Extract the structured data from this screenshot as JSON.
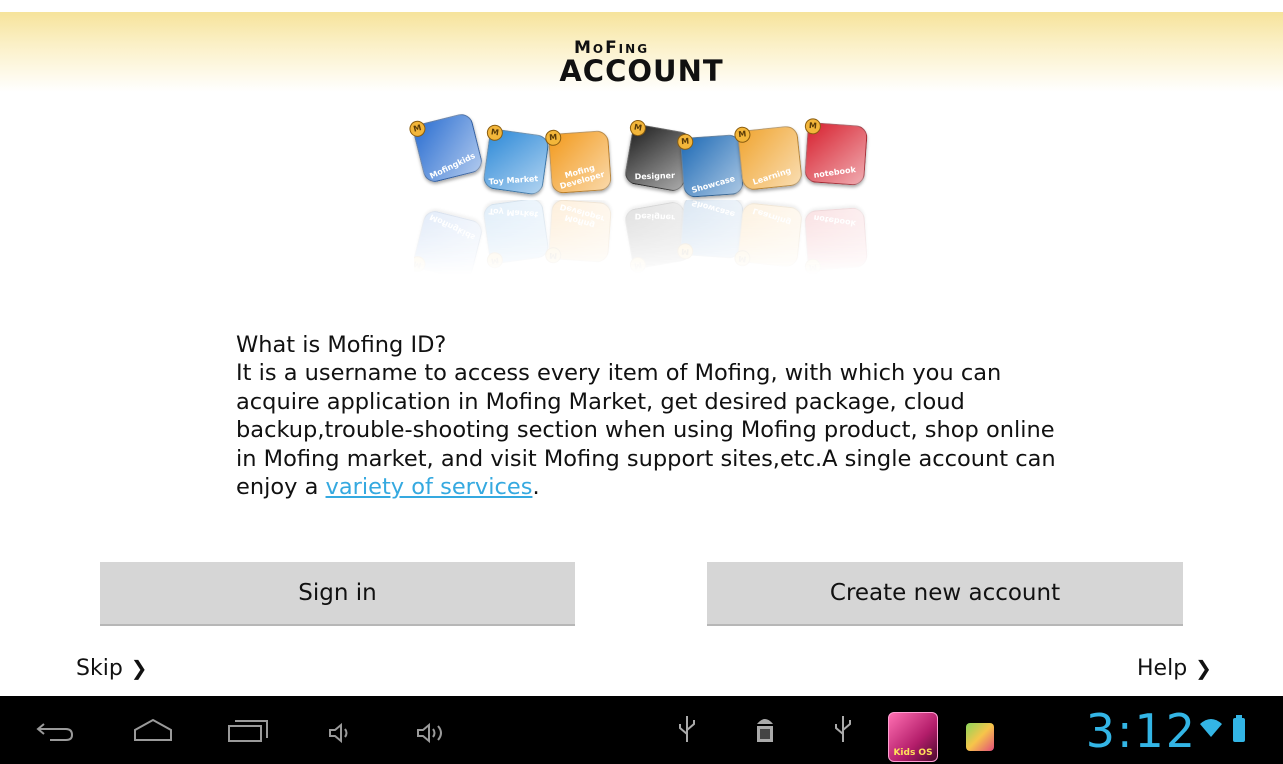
{
  "header": {
    "logo_line1": "MoFing",
    "logo_line2": "ACCOUNT"
  },
  "apps": [
    {
      "name": "Mofingkids",
      "color": "#2c6fd1"
    },
    {
      "name": "Toy Market",
      "color": "#2e8ad8"
    },
    {
      "name": "Mofing Developer",
      "color": "#f29a1d"
    },
    {
      "name": "Designer",
      "color": "#202020"
    },
    {
      "name": "Showcase",
      "color": "#1f6bb6"
    },
    {
      "name": "Learning",
      "color": "#f0a531"
    },
    {
      "name": "notebook",
      "color": "#d7212f"
    }
  ],
  "description": {
    "question": "What is Mofing ID?",
    "body": "It is a username to access every item of Mofing, with which you can acquire application in Mofing Market, get desired package, cloud backup,trouble-shooting section when using Mofing product, shop online in Mofing market, and visit Mofing support sites,etc.A single account can enjoy a ",
    "link": "variety of services",
    "end": "."
  },
  "buttons": {
    "signin": "Sign in",
    "create": "Create new account"
  },
  "links": {
    "skip": "Skip",
    "help": "Help"
  },
  "statusbar": {
    "clock": "3:12",
    "kids_label": "Kids OS"
  },
  "colors": {
    "accent": "#33b5e5",
    "button_bg": "#d6d6d6",
    "header_gradient": "#f6e39b"
  }
}
